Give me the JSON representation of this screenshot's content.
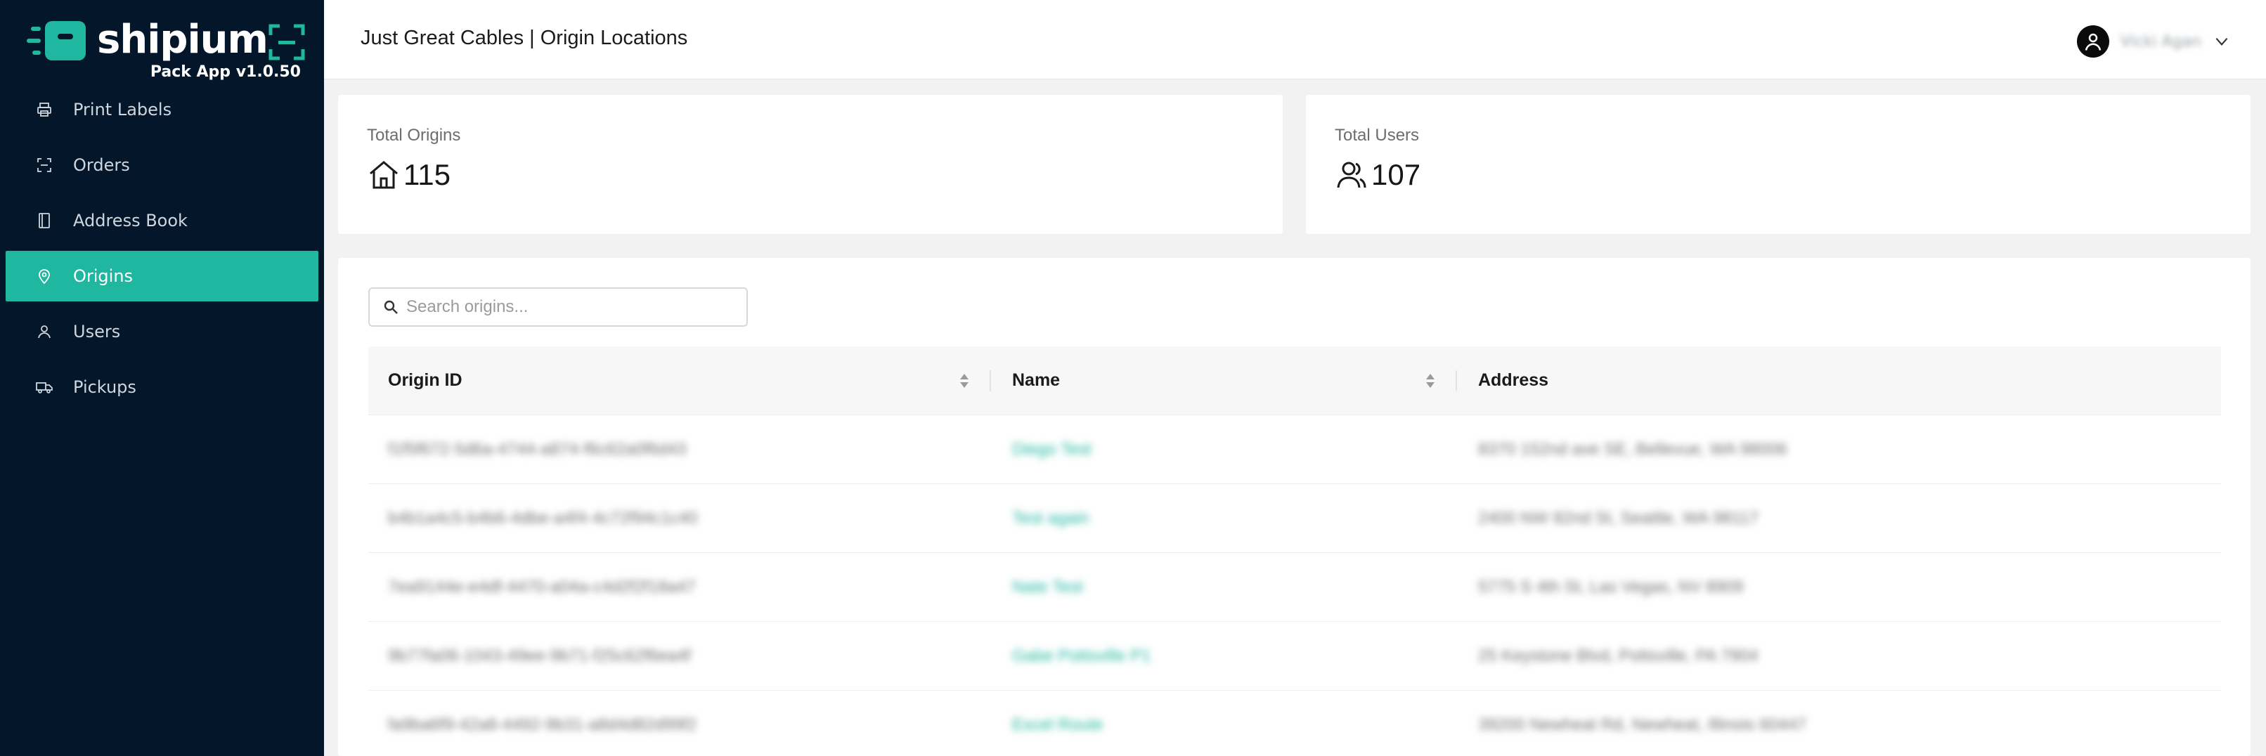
{
  "brand": {
    "name": "shipium",
    "version": "Pack App v1.0.50"
  },
  "sidebar": {
    "items": [
      {
        "label": "Print Labels",
        "icon": "printer-icon"
      },
      {
        "label": "Orders",
        "icon": "orders-icon"
      },
      {
        "label": "Address Book",
        "icon": "book-icon"
      },
      {
        "label": "Origins",
        "icon": "location-pin-icon",
        "active": true
      },
      {
        "label": "Users",
        "icon": "user-icon"
      },
      {
        "label": "Pickups",
        "icon": "truck-icon"
      }
    ]
  },
  "header": {
    "title": "Just Great Cables | Origin Locations",
    "user_name": "Vicki Agan"
  },
  "stats": {
    "origins": {
      "label": "Total Origins",
      "value": "115",
      "icon": "home-icon"
    },
    "users": {
      "label": "Total Users",
      "value": "107",
      "icon": "users-icon"
    }
  },
  "search": {
    "placeholder": "Search origins..."
  },
  "table": {
    "columns": [
      "Origin ID",
      "Name",
      "Address"
    ],
    "rows": [
      {
        "id": "f1f5f672-5d6a-4744-a874-f6c62a0f6d43",
        "name": "Diego Test",
        "address": "8370 152nd ave SE, Bellevue, WA 98006"
      },
      {
        "id": "b4b1a4c5-b4b6-4dbe-a4f4-4c72f94c1c40",
        "name": "Test again",
        "address": "2400 NW 82nd St, Seattle, WA 98117"
      },
      {
        "id": "7ea9144e-e4df-4470-a04a-c4d2f2f18a47",
        "name": "Nate Test",
        "address": "5775 S 4th St, Las Vegas, NV 8909"
      },
      {
        "id": "9b77fa06-1043-49ee-9b71-f25c62f6ea4f",
        "name": "Gabe Pottsville P1",
        "address": "25 Keystone Blvd, Pottsville, PA 7904"
      },
      {
        "id": "fa9ba6f9-42a8-4492-9b31-a8d4d82d99f2",
        "name": "Excel Route",
        "address": "39200 Newheat Rd, Newheat, Illinois 60447"
      }
    ]
  },
  "colors": {
    "sidebar_bg": "#03162a",
    "accent": "#1fb7a0"
  }
}
